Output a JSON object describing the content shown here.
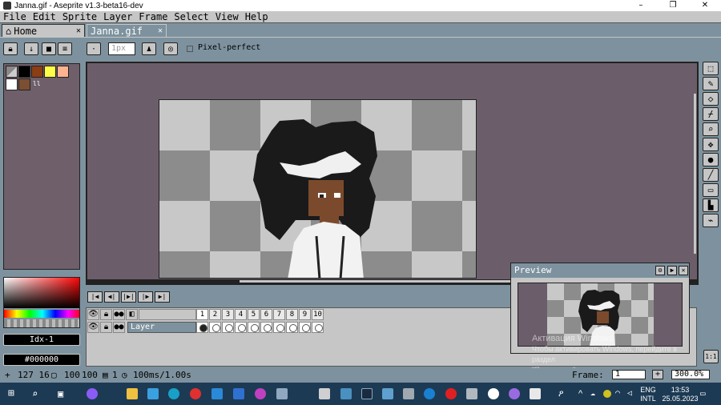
{
  "window": {
    "title": "Janna.gif - Aseprite v1.3-beta16-dev",
    "controls": [
      "–",
      "❐",
      "✕"
    ]
  },
  "menu": [
    "File",
    "Edit",
    "Sprite",
    "Layer",
    "Frame",
    "Select",
    "View",
    "Help"
  ],
  "tabs": [
    {
      "label": "Home",
      "icon": "home-icon",
      "close": "✕"
    },
    {
      "label": "Janna.gif",
      "close": "✕"
    }
  ],
  "context_bar": {
    "brush_size_placeholder": "1px",
    "pixel_perfect_label": "Pixel-perfect"
  },
  "palette": {
    "colors": [
      "#808080",
      "#000000",
      "#8b3e13",
      "#ffff46",
      "#fcb38f",
      "#ffffff",
      "#7b4f32"
    ]
  },
  "color_bar": {
    "index_label": "Idx-1",
    "hex_label": "#000000"
  },
  "timeline": {
    "frame_numbers": [
      "1",
      "2",
      "3",
      "4",
      "5",
      "6",
      "7",
      "8",
      "9",
      "10"
    ],
    "layer_name": "Layer"
  },
  "preview": {
    "title": "Preview"
  },
  "activation": {
    "line1": "Активация Windows",
    "line2": "Чтобы активировать Windows, перейдите в раздел",
    "line3": "\"Параметры\"."
  },
  "statusbar": {
    "position": "127 16",
    "size_w": "100",
    "size_h": "100",
    "frame_info": "1",
    "duration": "100ms/1.00s",
    "frame_label": "Frame:",
    "frame_value": "1",
    "zoom": "300.0%",
    "add_label": "+"
  },
  "taskbar": {
    "lang1": "ENG",
    "lang2": "INTL",
    "time": "13:53",
    "date": "25.05.2023"
  }
}
